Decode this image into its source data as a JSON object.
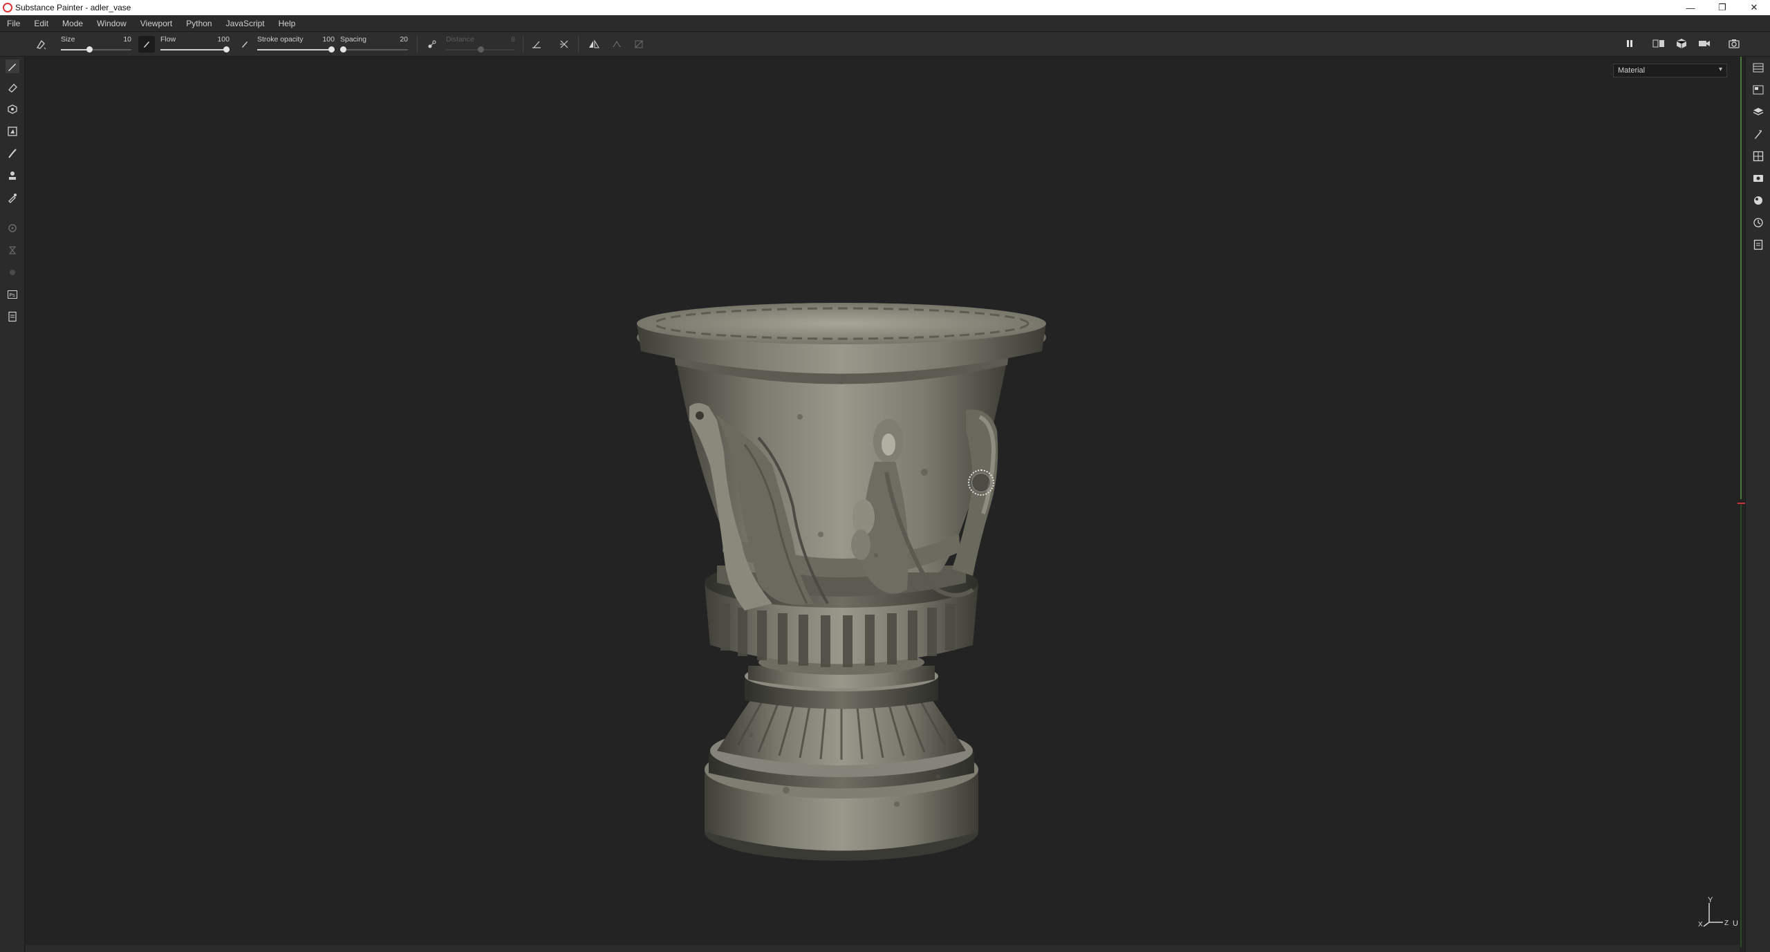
{
  "window": {
    "title": "Substance Painter - adler_vase",
    "controls": {
      "minimize": "—",
      "restore": "❐",
      "close": "✕"
    }
  },
  "menu": [
    "File",
    "Edit",
    "Mode",
    "Window",
    "Viewport",
    "Python",
    "JavaScript",
    "Help"
  ],
  "toolbar": {
    "size": {
      "label": "Size",
      "value": "10",
      "fraction": 0.4
    },
    "flow": {
      "label": "Flow",
      "value": "100",
      "fraction": 1.0
    },
    "stroke_opacity": {
      "label": "Stroke opacity",
      "value": "100",
      "fraction": 1.0
    },
    "spacing": {
      "label": "Spacing",
      "value": "20",
      "fraction": 0.02
    },
    "distance": {
      "label": "Distance",
      "value": "8",
      "fraction": 0.5,
      "disabled": true
    }
  },
  "viewport": {
    "channel_select": "Material",
    "scene": "3D model of a stone urn vase with eagle reliefs",
    "axis": {
      "y": "Y",
      "x": "X",
      "z": "Z",
      "u": "U"
    }
  },
  "colors": {
    "panel": "#2b2b2b",
    "viewport_bg": "#232323",
    "accent_green": "#4a7a3c",
    "accent_red": "#cc3333"
  },
  "left_tools": [
    "paint-brush-icon",
    "eraser-icon",
    "projection-icon",
    "polygon-fill-icon",
    "smudge-icon",
    "clone-stamp-icon",
    "color-picker-icon",
    "bake-settings-icon",
    "iray-icon",
    "dim-tool-icon",
    "photoshop-export-icon",
    "script-icon"
  ],
  "right_tools": [
    "texture-set-list-icon",
    "texture-set-settings-icon",
    "layers-icon",
    "properties-icon",
    "display-settings-icon",
    "viewer-settings-icon",
    "shader-settings-icon",
    "history-icon",
    "log-icon"
  ]
}
